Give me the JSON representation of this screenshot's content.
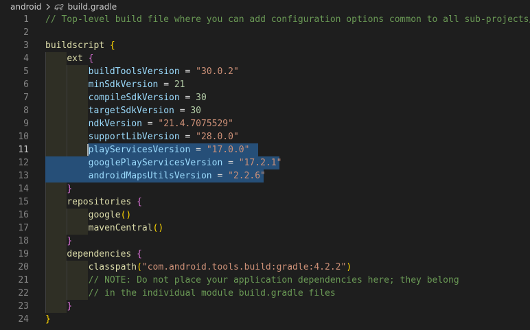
{
  "breadcrumb": {
    "folder": "android",
    "file": "build.gradle",
    "file_icon": "gradle-elephant-icon"
  },
  "colors": {
    "background": "#1e1e1e",
    "comment": "#6a9955",
    "string": "#ce9178",
    "number": "#b5cea8",
    "selection": "#264f78"
  },
  "editor": {
    "active_line": 11,
    "lines": [
      {
        "n": "1",
        "code": "// Top-level build file where you can add configuration options common to all sub-projects/m"
      },
      {
        "n": "2",
        "code": ""
      },
      {
        "n": "3",
        "code": "buildscript {"
      },
      {
        "n": "4",
        "code": "    ext {"
      },
      {
        "n": "5",
        "code": "        buildToolsVersion = \"30.0.2\""
      },
      {
        "n": "6",
        "code": "        minSdkVersion = 21"
      },
      {
        "n": "7",
        "code": "        compileSdkVersion = 30"
      },
      {
        "n": "8",
        "code": "        targetSdkVersion = 30"
      },
      {
        "n": "9",
        "code": "        ndkVersion = \"21.4.7075529\""
      },
      {
        "n": "10",
        "code": "        supportLibVersion = \"28.0.0\""
      },
      {
        "n": "11",
        "code": "        playServicesVersion = \"17.0.0\""
      },
      {
        "n": "12",
        "code": "        googlePlayServicesVersion = \"17.2.1\""
      },
      {
        "n": "13",
        "code": "        androidMapsUtilsVersion = \"2.2.6\""
      },
      {
        "n": "14",
        "code": "    }"
      },
      {
        "n": "15",
        "code": "    repositories {"
      },
      {
        "n": "16",
        "code": "        google()"
      },
      {
        "n": "17",
        "code": "        mavenCentral()"
      },
      {
        "n": "18",
        "code": "    }"
      },
      {
        "n": "19",
        "code": "    dependencies {"
      },
      {
        "n": "20",
        "code": "        classpath(\"com.android.tools.build:gradle:4.2.2\")"
      },
      {
        "n": "21",
        "code": "        // NOTE: Do not place your application dependencies here; they belong"
      },
      {
        "n": "22",
        "code": "        // in the individual module build.gradle files"
      },
      {
        "n": "23",
        "code": "    }"
      },
      {
        "n": "24",
        "code": "}"
      }
    ]
  }
}
